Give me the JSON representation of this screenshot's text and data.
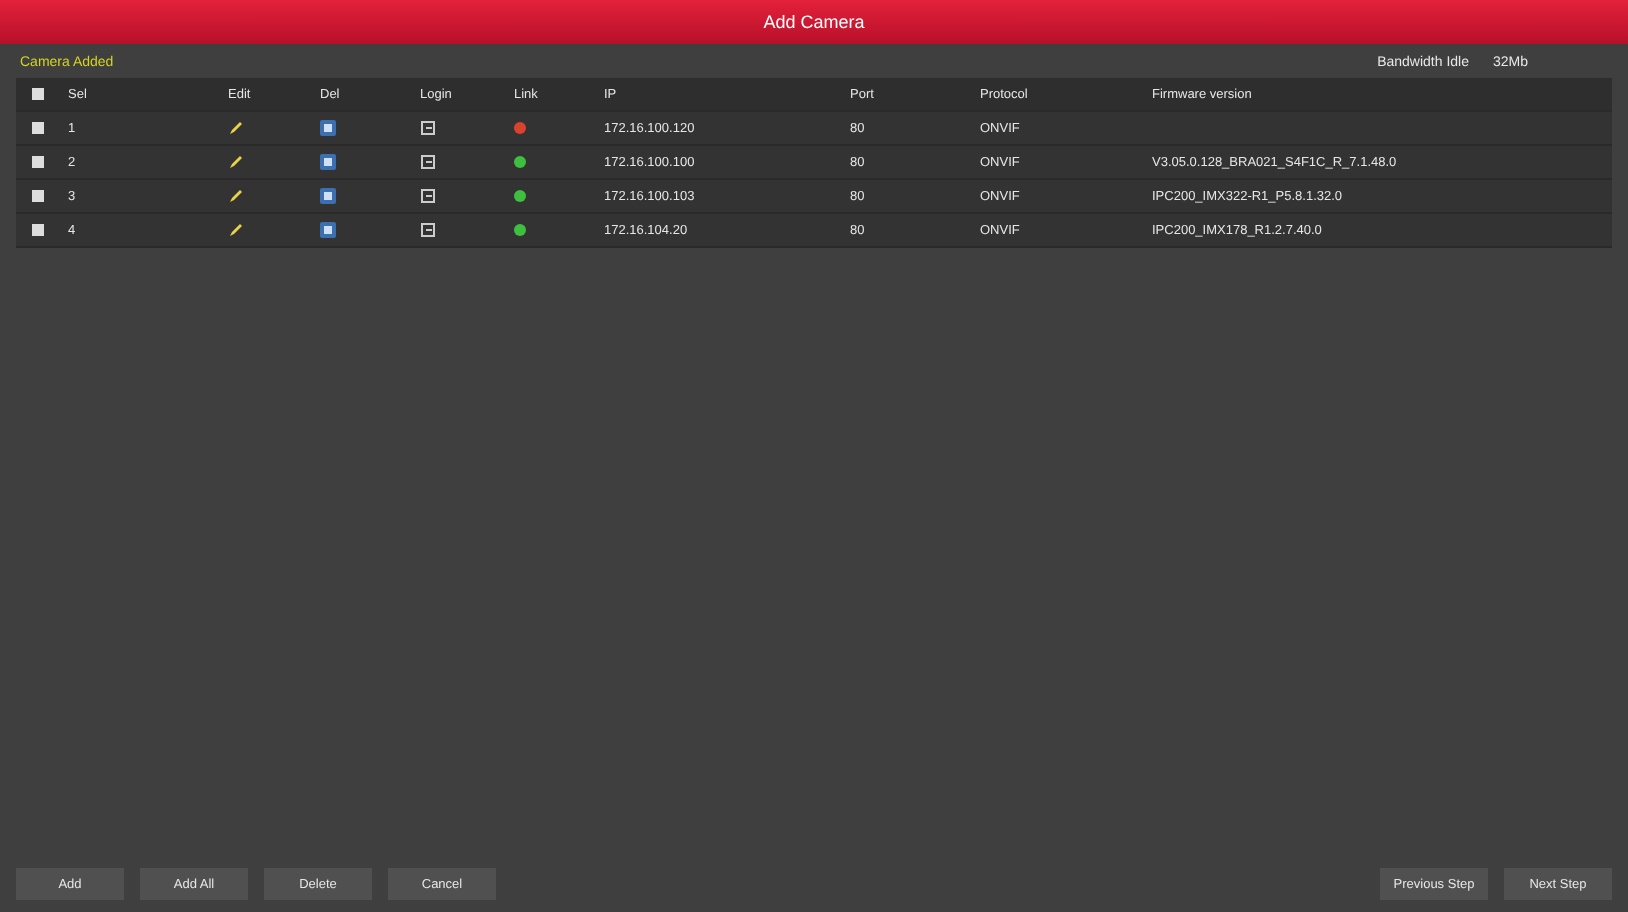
{
  "window": {
    "title": "Add Camera"
  },
  "section_title": "Camera Added",
  "bandwidth": {
    "label": "Bandwidth Idle",
    "value": "32Mb"
  },
  "table": {
    "all_checked": false,
    "columns": [
      "Sel",
      "Edit",
      "Del",
      "Login",
      "Link",
      "IP",
      "Port",
      "Protocol",
      "Firmware version"
    ],
    "rows": [
      {
        "checked": false,
        "num": "1",
        "color": "#d9432e",
        "ip": "172.16.100.120",
        "port": "80",
        "protocol": "ONVIF",
        "firmware": ""
      },
      {
        "checked": false,
        "num": "2",
        "color": "#3fbf3f",
        "ip": "172.16.100.100",
        "port": "80",
        "protocol": "ONVIF",
        "firmware": "V3.05.0.128_BRA021_S4F1C_R_7.1.48.0"
      },
      {
        "checked": false,
        "num": "3",
        "color": "#3fbf3f",
        "ip": "172.16.100.103",
        "port": "80",
        "protocol": "ONVIF",
        "firmware": "IPC200_IMX322-R1_P5.8.1.32.0"
      },
      {
        "checked": false,
        "num": "4",
        "color": "#3fbf3f",
        "ip": "172.16.104.20",
        "port": "80",
        "protocol": "ONVIF",
        "firmware": "IPC200_IMX178_R1.2.7.40.0"
      }
    ]
  },
  "buttons_left": [
    "Add",
    "Add All",
    "Delete",
    "Cancel"
  ],
  "buttons_right": [
    "Previous Step",
    "Next Step"
  ]
}
